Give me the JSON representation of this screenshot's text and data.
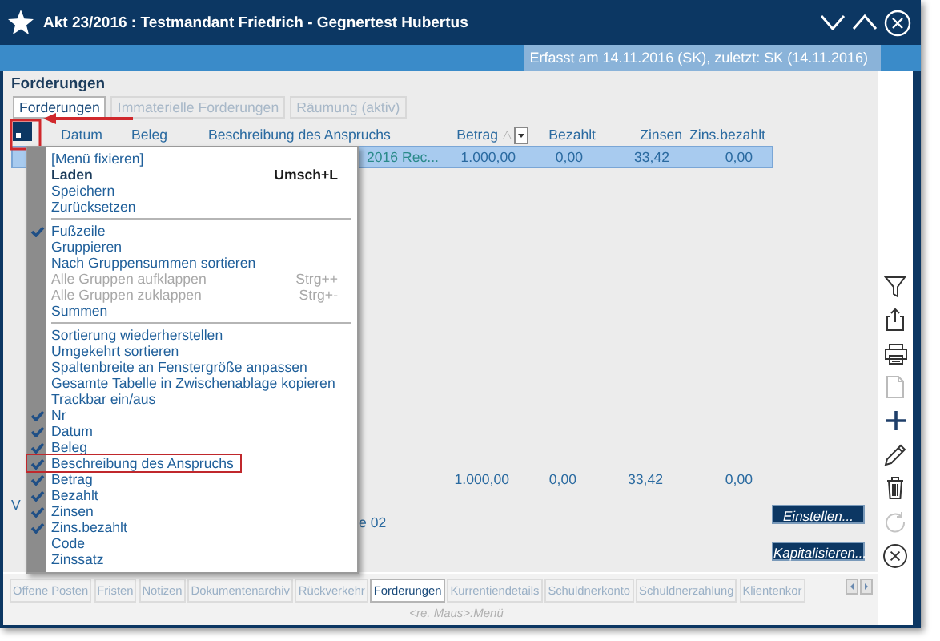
{
  "window": {
    "title": "Akt 23/2016 : Testmandant Friedrich - Gegnertest Hubertus"
  },
  "info_bar": {
    "text": "Erfasst am 14.11.2016 (SK), zuletzt: SK (14.11.2016)"
  },
  "section_title": "Forderungen",
  "tabs": [
    {
      "label": "Forderungen",
      "selected": true
    },
    {
      "label": "Immaterielle Forderungen",
      "selected": false
    },
    {
      "label": "Räumung (aktiv)",
      "selected": false
    }
  ],
  "table": {
    "columns": [
      {
        "label": "Datum"
      },
      {
        "label": "Beleg"
      },
      {
        "label": "Beschreibung des Anspruchs"
      },
      {
        "label": "Betrag",
        "sort_indicator": "△"
      },
      {
        "label": "Bezahlt"
      },
      {
        "label": "Zinsen"
      },
      {
        "label": "Zins.bezahlt"
      }
    ],
    "rows": [
      {
        "selected": true,
        "cells": [
          "",
          "",
          "2016 Rec...",
          "1.000,00",
          "0,00",
          "33,42",
          "0,00"
        ]
      }
    ],
    "totals": [
      "1.000,00",
      "0,00",
      "33,42",
      "0,00"
    ]
  },
  "covered_texts": [
    "V",
    "e 02"
  ],
  "buttons": [
    "Einstellen...",
    "Kapitalisieren..."
  ],
  "bottom_tabs": [
    {
      "label": "Offene Posten",
      "selected": false
    },
    {
      "label": "Fristen",
      "selected": false
    },
    {
      "label": "Notizen",
      "selected": false
    },
    {
      "label": "Dokumentenarchiv",
      "selected": false
    },
    {
      "label": "Rückverkehr",
      "selected": false
    },
    {
      "label": "Forderungen",
      "selected": true
    },
    {
      "label": "Kurrentiendetails",
      "selected": false
    },
    {
      "label": "Schuldnerkonto",
      "selected": false
    },
    {
      "label": "Schuldnerzahlung",
      "selected": false
    },
    {
      "label": "Klientenkor",
      "selected": false
    }
  ],
  "status_hint": "<re. Maus>:Menü",
  "context_menu": {
    "items": [
      {
        "kind": "command",
        "label": "[Menü fixieren]",
        "checked": false,
        "disabled": false,
        "highlighted": false
      },
      {
        "kind": "default",
        "label": "Laden",
        "shortcut": "Umsch+L",
        "checked": false,
        "disabled": false,
        "highlighted": false
      },
      {
        "kind": "command",
        "label": "Speichern",
        "checked": false,
        "disabled": false,
        "highlighted": false
      },
      {
        "kind": "command",
        "label": "Zurücksetzen",
        "checked": false,
        "disabled": false,
        "highlighted": false
      },
      {
        "kind": "separator"
      },
      {
        "kind": "command",
        "label": "Fußzeile",
        "checked": true,
        "disabled": false,
        "highlighted": false
      },
      {
        "kind": "command",
        "label": "Gruppieren",
        "checked": false,
        "disabled": false,
        "highlighted": false
      },
      {
        "kind": "command",
        "label": "Nach Gruppensummen sortieren",
        "checked": false,
        "disabled": false,
        "highlighted": false
      },
      {
        "kind": "command",
        "label": "Alle Gruppen aufklappen",
        "shortcut": "Strg++",
        "checked": false,
        "disabled": true,
        "highlighted": false
      },
      {
        "kind": "command",
        "label": "Alle Gruppen zuklappen",
        "shortcut": "Strg+-",
        "checked": false,
        "disabled": true,
        "highlighted": false
      },
      {
        "kind": "command",
        "label": "Summen",
        "checked": false,
        "disabled": false,
        "highlighted": false
      },
      {
        "kind": "separator"
      },
      {
        "kind": "command",
        "label": "Sortierung wiederherstellen",
        "checked": false,
        "disabled": false,
        "highlighted": false
      },
      {
        "kind": "command",
        "label": "Umgekehrt sortieren",
        "checked": false,
        "disabled": false,
        "highlighted": false
      },
      {
        "kind": "command",
        "label": "Spaltenbreite an Fenstergröße anpassen",
        "checked": false,
        "disabled": false,
        "highlighted": false
      },
      {
        "kind": "command",
        "label": "Gesamte Tabelle in Zwischenablage kopieren",
        "checked": false,
        "disabled": false,
        "highlighted": false
      },
      {
        "kind": "command",
        "label": "Trackbar ein/aus",
        "checked": false,
        "disabled": false,
        "highlighted": false
      },
      {
        "kind": "command",
        "label": "Nr",
        "checked": true,
        "disabled": false,
        "highlighted": false
      },
      {
        "kind": "command",
        "label": "Datum",
        "checked": true,
        "disabled": false,
        "highlighted": false
      },
      {
        "kind": "command",
        "label": "Beleg",
        "checked": true,
        "disabled": false,
        "highlighted": false
      },
      {
        "kind": "command",
        "label": "Beschreibung des Anspruchs",
        "checked": true,
        "disabled": false,
        "highlighted": true
      },
      {
        "kind": "command",
        "label": "Betrag",
        "checked": true,
        "disabled": false,
        "highlighted": false
      },
      {
        "kind": "command",
        "label": "Bezahlt",
        "checked": true,
        "disabled": false,
        "highlighted": false
      },
      {
        "kind": "command",
        "label": "Zinsen",
        "checked": true,
        "disabled": false,
        "highlighted": false
      },
      {
        "kind": "command",
        "label": "Zins.bezahlt",
        "checked": true,
        "disabled": false,
        "highlighted": false
      },
      {
        "kind": "command",
        "label": "Code",
        "checked": false,
        "disabled": false,
        "highlighted": false
      },
      {
        "kind": "command",
        "label": "Zinssatz",
        "checked": false,
        "disabled": false,
        "highlighted": false
      }
    ]
  }
}
